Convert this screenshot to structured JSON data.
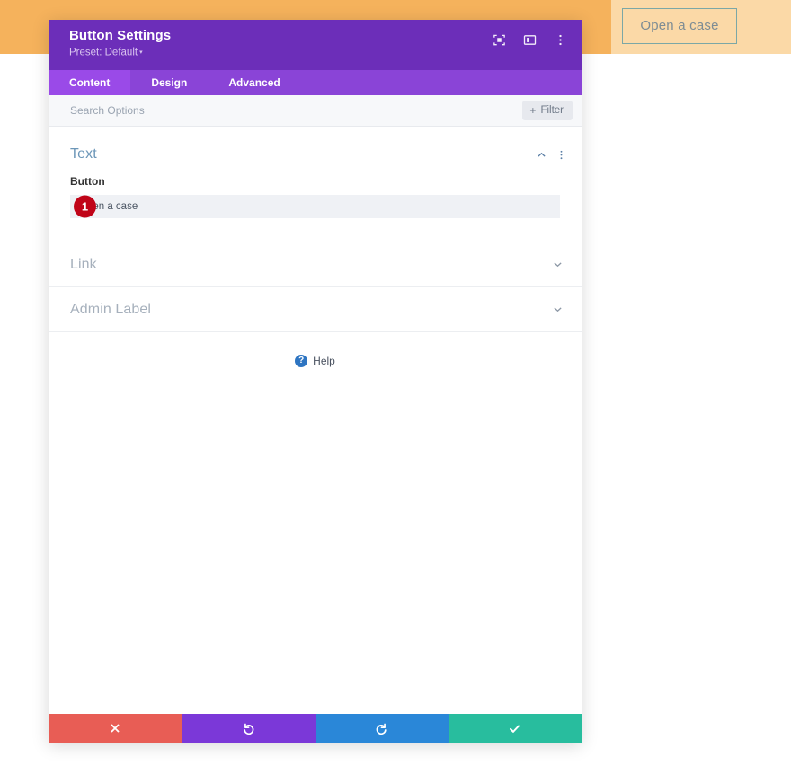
{
  "page": {
    "open_case_button": "Open a case",
    "bg_orange": "#f5b25c",
    "bg_peach": "#fbd9a7",
    "open_case_border": "#7ba7a6",
    "open_case_text_color": "#7d8c94"
  },
  "modal": {
    "title": "Button Settings",
    "preset": "Preset: Default",
    "preset_caret": "▾",
    "header_bg": "#6c2eb9",
    "tabs_bg": "#8a44d7",
    "tab_active_bg": "#9a4ae8",
    "header_icons": [
      {
        "name": "focus-icon",
        "glyph": "focus"
      },
      {
        "name": "layout-panel-icon",
        "glyph": "layout"
      },
      {
        "name": "more-vertical-icon",
        "glyph": "dots"
      }
    ],
    "tabs": [
      {
        "label": "Content",
        "active": true
      },
      {
        "label": "Design",
        "active": false
      },
      {
        "label": "Advanced",
        "active": false
      }
    ],
    "search": {
      "placeholder": "Search Options",
      "value": "",
      "filter_label": "Filter",
      "filter_plus": "+"
    },
    "sections": {
      "text": {
        "title": "Text",
        "expanded": true,
        "field_label": "Button",
        "field_value": "Open a case",
        "step_badge": "1",
        "step_badge_color": "#c00418"
      },
      "link": {
        "title": "Link",
        "expanded": false
      },
      "admin_label": {
        "title": "Admin Label",
        "expanded": false
      }
    },
    "help": {
      "label": "Help",
      "icon_glyph": "?",
      "icon_color": "#2e75c2"
    },
    "footer": [
      {
        "name": "cancel-button",
        "glyph": "✖",
        "color": "#e85d55"
      },
      {
        "name": "undo-button",
        "glyph": "↺",
        "color": "#7b38d8"
      },
      {
        "name": "redo-button",
        "glyph": "↻",
        "color": "#2a87d8"
      },
      {
        "name": "save-button",
        "glyph": "✔",
        "color": "#28bd9e"
      }
    ]
  }
}
